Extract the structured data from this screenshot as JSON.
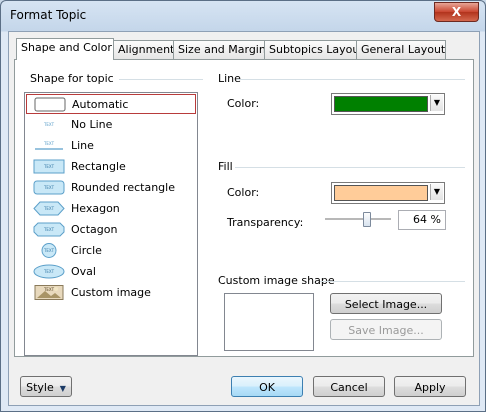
{
  "window": {
    "title": "Format Topic",
    "close_glyph": "X"
  },
  "tabs": [
    {
      "label": "Shape and Color",
      "active": true
    },
    {
      "label": "Alignment"
    },
    {
      "label": "Size and Margins"
    },
    {
      "label": "Subtopics Layout"
    },
    {
      "label": "General Layout"
    }
  ],
  "shape_section": {
    "title": "Shape for topic",
    "icon_text": "TEXT",
    "items": [
      {
        "label": "Automatic",
        "icon": "automatic-shape-icon",
        "selected": true
      },
      {
        "label": "No Line",
        "icon": "no-line-shape-icon"
      },
      {
        "label": "Line",
        "icon": "line-shape-icon"
      },
      {
        "label": "Rectangle",
        "icon": "rectangle-shape-icon"
      },
      {
        "label": "Rounded rectangle",
        "icon": "rounded-rectangle-shape-icon"
      },
      {
        "label": "Hexagon",
        "icon": "hexagon-shape-icon"
      },
      {
        "label": "Octagon",
        "icon": "octagon-shape-icon"
      },
      {
        "label": "Circle",
        "icon": "circle-shape-icon"
      },
      {
        "label": "Oval",
        "icon": "oval-shape-icon"
      },
      {
        "label": "Custom image",
        "icon": "custom-image-shape-icon"
      }
    ]
  },
  "line_section": {
    "title": "Line",
    "color_label": "Color:",
    "color": "#008000"
  },
  "fill_section": {
    "title": "Fill",
    "color_label": "Color:",
    "color": "#ffcc99",
    "transparency_label": "Transparency:",
    "transparency_value": "64 %",
    "transparency_level": 0.64
  },
  "custom_image_section": {
    "title": "Custom image shape",
    "select_button": "Select Image...",
    "save_button": "Save Image..."
  },
  "footer": {
    "style_button": "Style",
    "ok_button": "OK",
    "cancel_button": "Cancel",
    "apply_button": "Apply"
  },
  "colors": {
    "shape_fill": "#c9e8f7",
    "shape_stroke": "#5b9fc9",
    "selection_border": "#b83b3b"
  }
}
